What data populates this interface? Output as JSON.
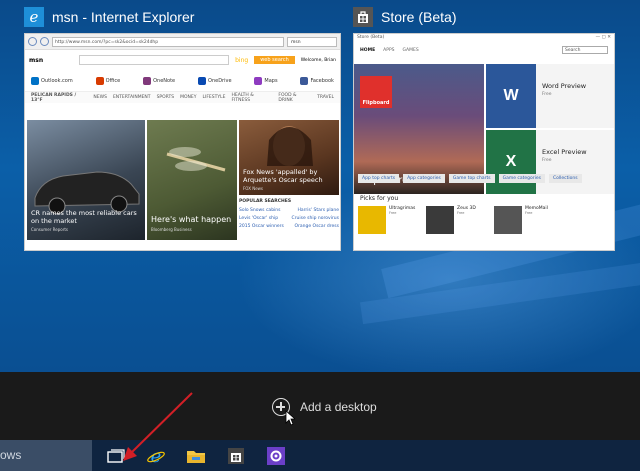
{
  "windows": [
    {
      "title": "msn - Internet Explorer",
      "icon": "internet-explorer-icon",
      "content": {
        "address": "http://www.msn.com/?pc=sk2&ocid=sk24dhp",
        "tab": "msn",
        "site": "msn",
        "bing": "bing",
        "web_search": "web search",
        "welcome": "Welcome, Brian",
        "quick_links": [
          "Outlook.com",
          "Office",
          "OneNote",
          "OneDrive",
          "Maps",
          "Facebook"
        ],
        "location": "PELICAN RAPIDS / 13°F",
        "nav": [
          "NEWS",
          "ENTERTAINMENT",
          "SPORTS",
          "MONEY",
          "LIFESTYLE",
          "HEALTH & FITNESS",
          "FOOD & DRINK",
          "TRAVEL"
        ],
        "story1": "CR names the most reliable cars on the market",
        "story1_src": "Consumer Reports",
        "story2": "Here's what happen",
        "story2_src": "Bloomberg Business",
        "story3": "Fox News 'appalled' by Arquette's Oscar speech",
        "story3_src": "FOX News",
        "popular_title": "POPULAR SEARCHES",
        "popular": [
          [
            "Solo Snows cabins",
            "Harris' Stars plane"
          ],
          [
            "Levis 'Oscar' ship",
            "Cruise ship norovirus"
          ],
          [
            "2015 Oscar winners",
            "Orange Oscar dress"
          ]
        ]
      }
    },
    {
      "title": "Store (Beta)",
      "icon": "store-icon",
      "content": {
        "window_label": "Store (Beta)",
        "nav": [
          "HOME",
          "APPS",
          "GAMES"
        ],
        "search": "Search",
        "hero_app": "Flipboard",
        "hero_logo": "Flipboard",
        "tiles": [
          {
            "name": "Word Preview",
            "price": "Free",
            "color": "#2b579a",
            "letter": "W"
          },
          {
            "name": "Excel Preview",
            "price": "Free",
            "color": "#217346",
            "letter": "X"
          }
        ],
        "chips": [
          "App top charts",
          "App categories",
          "Game top charts",
          "Game categories",
          "Collections"
        ],
        "picks_title": "Picks for you",
        "picks": [
          {
            "name": "Ultragrimas",
            "sub": "Free",
            "color": "#e8b800"
          },
          {
            "name": "Zeus 3D",
            "sub": "Free",
            "color": "#3a3a3a"
          },
          {
            "name": "MemoMail",
            "sub": "Free",
            "color": "#555555"
          }
        ]
      }
    }
  ],
  "virtual_desktops": {
    "add_label": "Add a desktop"
  },
  "taskbar": {
    "search_text": "ows",
    "buttons": [
      "task-view-icon",
      "internet-explorer-icon",
      "file-explorer-icon",
      "store-icon",
      "settings-icon"
    ]
  },
  "colors": {
    "desktop": "#0b5fa8",
    "strip": "#1a1a1a",
    "taskbar": "#0f2440",
    "annotation_arrow": "#d21f26"
  }
}
